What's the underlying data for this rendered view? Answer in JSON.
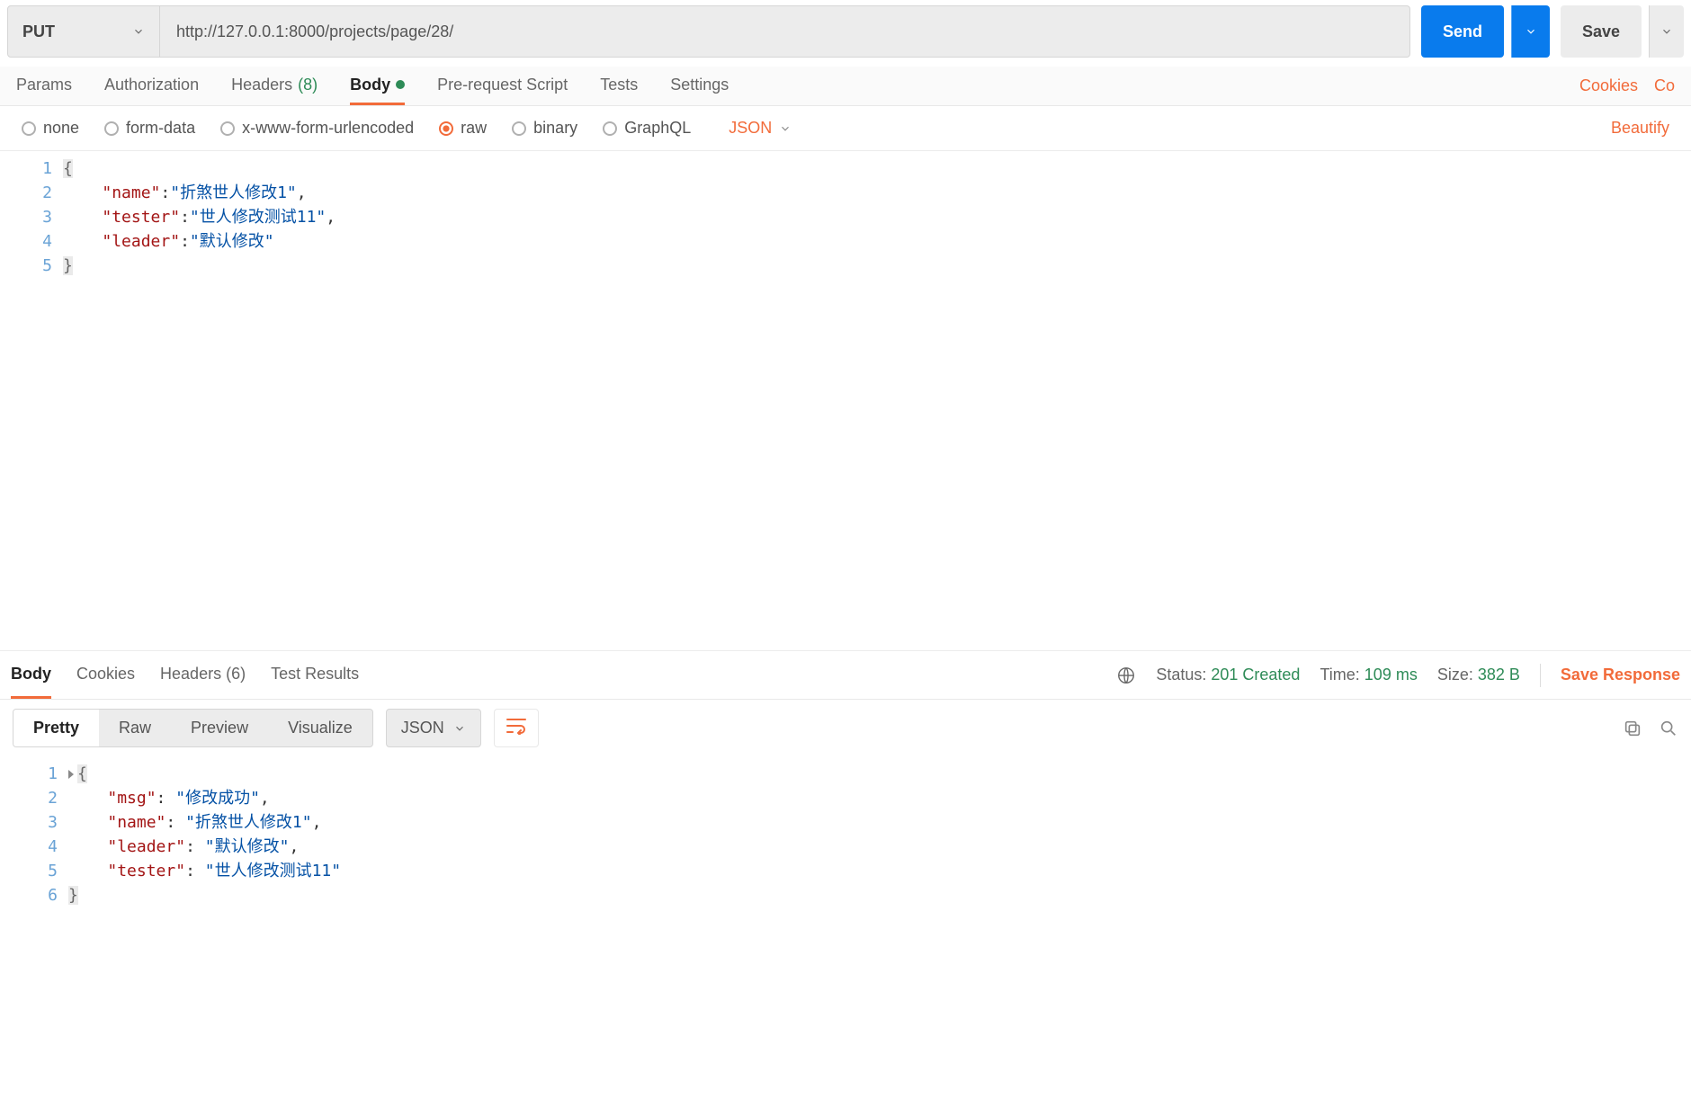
{
  "request": {
    "method": "PUT",
    "url": "http://127.0.0.1:8000/projects/page/28/",
    "send_label": "Send",
    "save_label": "Save"
  },
  "tabs": {
    "items": [
      "Params",
      "Authorization",
      "Headers",
      "Body",
      "Pre-request Script",
      "Tests",
      "Settings"
    ],
    "headers_count": "(8)",
    "cookies_label": "Cookies",
    "code_label": "Co"
  },
  "body_type": {
    "options": [
      "none",
      "form-data",
      "x-www-form-urlencoded",
      "raw",
      "binary",
      "GraphQL"
    ],
    "selected": "raw",
    "format": "JSON",
    "beautify_label": "Beautify"
  },
  "request_body": {
    "line_numbers": [
      "1",
      "2",
      "3",
      "4",
      "5"
    ],
    "kv": [
      {
        "key": "name",
        "val": "折煞世人修改1",
        "comma": true
      },
      {
        "key": "tester",
        "val": "世人修改测试11",
        "comma": true
      },
      {
        "key": "leader",
        "val": "默认修改",
        "comma": false
      }
    ]
  },
  "response_tabs": {
    "items": [
      "Body",
      "Cookies",
      "Headers",
      "Test Results"
    ],
    "headers_count": "(6)",
    "status_label": "Status:",
    "status_value": "201 Created",
    "time_label": "Time:",
    "time_value": "109 ms",
    "size_label": "Size:",
    "size_value": "382 B",
    "save_response_label": "Save Response"
  },
  "response_toolbar": {
    "view_modes": [
      "Pretty",
      "Raw",
      "Preview",
      "Visualize"
    ],
    "format": "JSON"
  },
  "response_body": {
    "line_numbers": [
      "1",
      "2",
      "3",
      "4",
      "5",
      "6"
    ],
    "kv": [
      {
        "key": "msg",
        "val": "修改成功",
        "comma": true
      },
      {
        "key": "name",
        "val": "折煞世人修改1",
        "comma": true
      },
      {
        "key": "leader",
        "val": "默认修改",
        "comma": true
      },
      {
        "key": "tester",
        "val": "世人修改测试11",
        "comma": false
      }
    ]
  }
}
